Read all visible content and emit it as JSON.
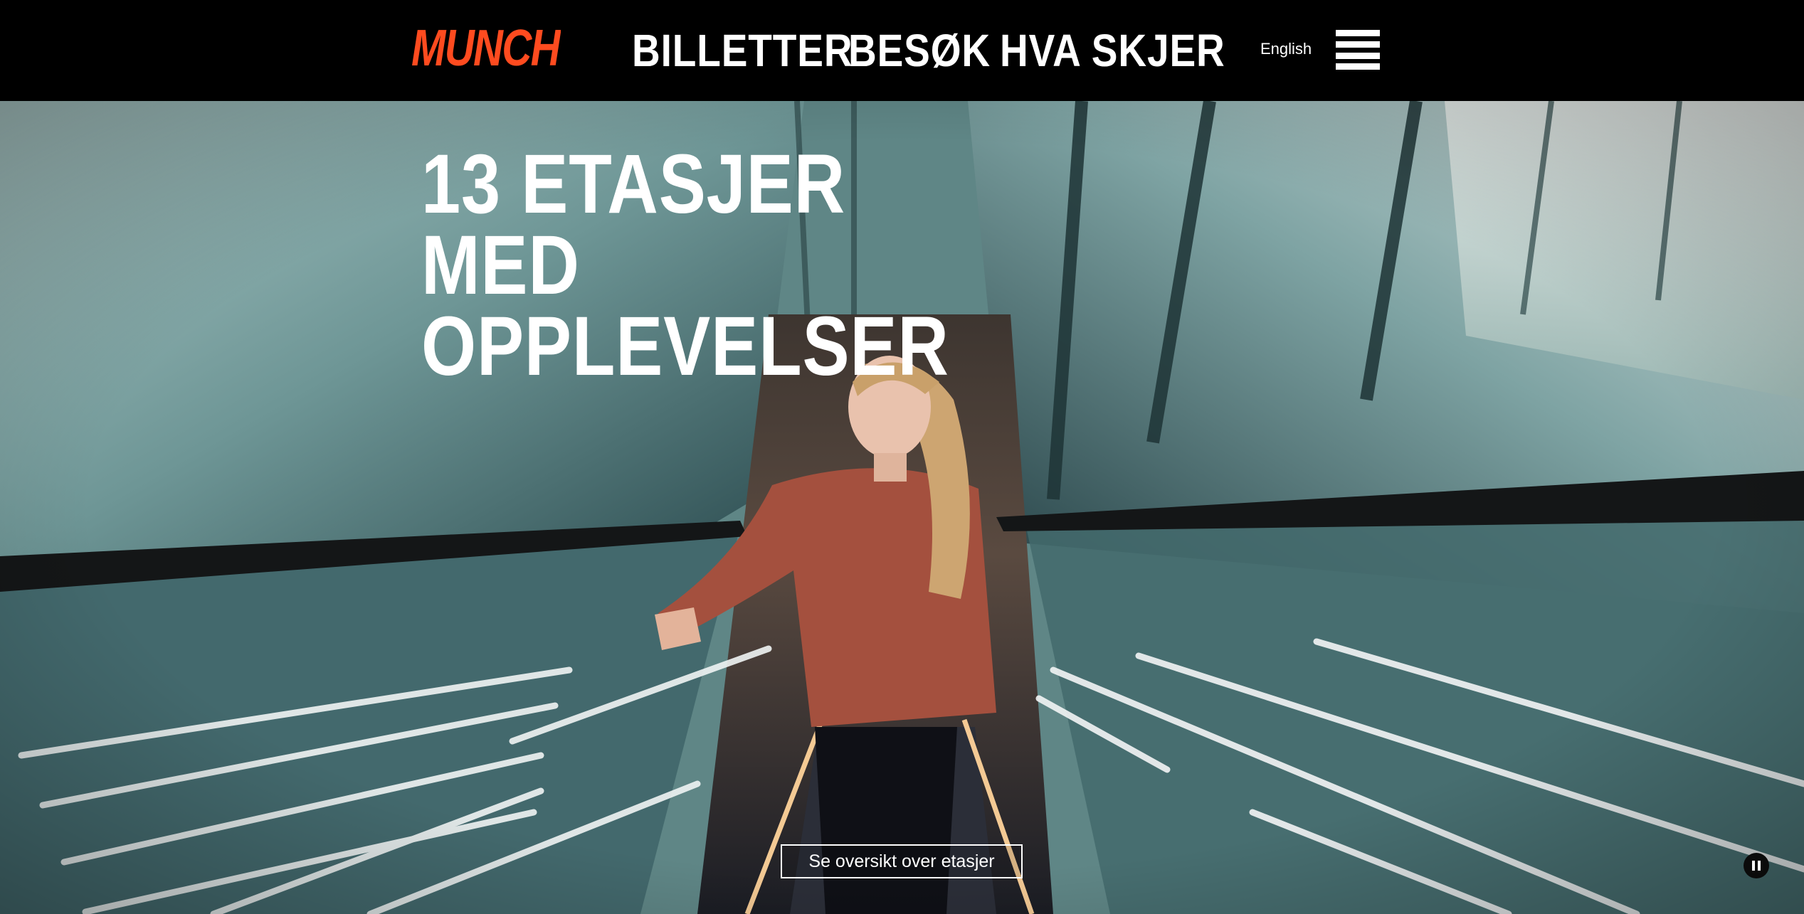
{
  "header": {
    "logo_text": "MUNCH",
    "nav": [
      {
        "label": "BILLETTER"
      },
      {
        "label": "BESØK"
      },
      {
        "label": "HVA SKJER"
      }
    ],
    "language_label": "English",
    "menu_icon": "hamburger-menu-icon"
  },
  "hero": {
    "headline": "13 ETASJER MED\nOPPLEVELSER",
    "cta_label": "Se oversikt over etasjer",
    "pause_icon": "pause-icon",
    "image_description_icon": "escalator-photo"
  },
  "colors": {
    "brand_accent": "#ff4b1f",
    "header_background": "#000000",
    "text_on_dark": "#ffffff"
  }
}
